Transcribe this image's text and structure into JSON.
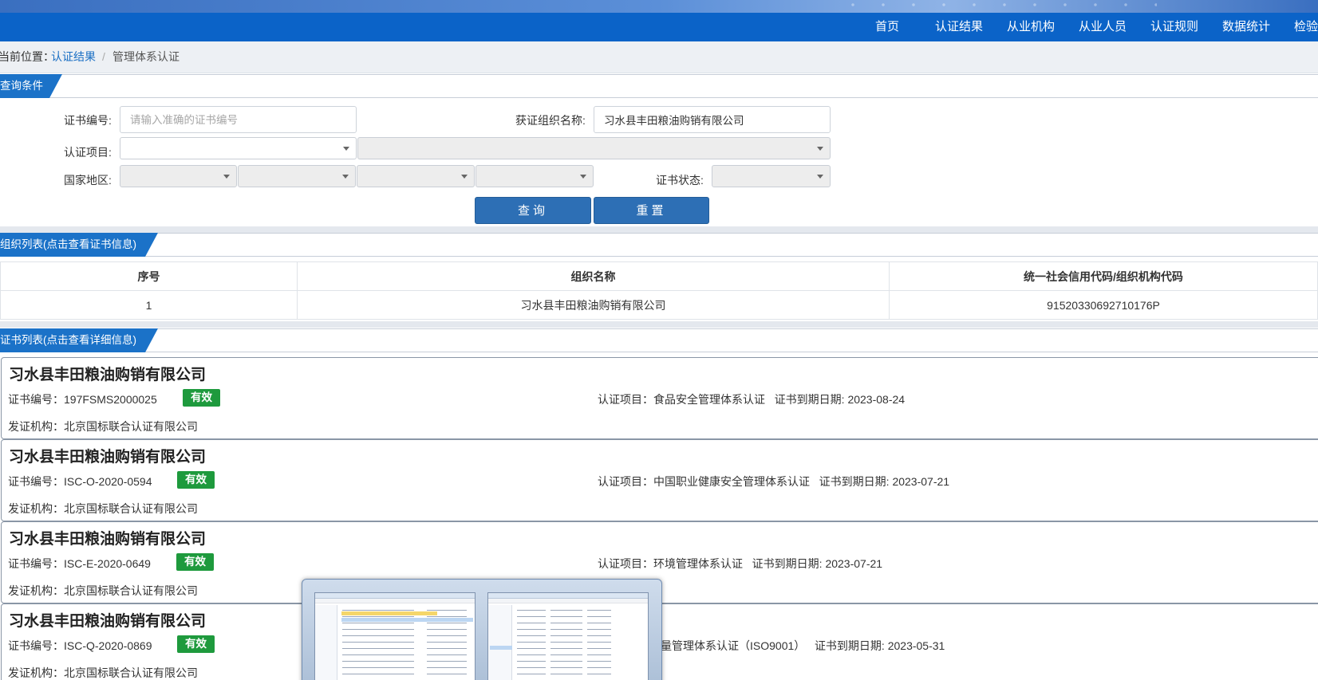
{
  "nav": [
    "首页",
    "认证结果",
    "从业机构",
    "从业人员",
    "认证规则",
    "数据统计",
    "检验"
  ],
  "breadcrumb": {
    "prefix": "当前位置：",
    "link": "认证结果",
    "sep": "/",
    "current": "管理体系认证"
  },
  "query": {
    "section_title": "查询条件",
    "cert_no_label": "证书编号:",
    "cert_no_placeholder": "请输入准确的证书编号",
    "org_name_label": "获证组织名称:",
    "org_name_value": "习水县丰田粮油购销有限公司",
    "cert_item_label": "认证项目:",
    "region_label": "国家地区:",
    "status_label": "证书状态:",
    "search_btn": "查询",
    "reset_btn": "重置"
  },
  "org_list": {
    "section_title": "组织列表(点击查看证书信息)",
    "headers": [
      "序号",
      "组织名称",
      "统一社会信用代码/组织机构代码"
    ],
    "rows": [
      [
        "1",
        "习水县丰田粮油购销有限公司",
        "91520330692710176P"
      ]
    ]
  },
  "cert_list": {
    "section_title": "证书列表(点击查看详细信息)",
    "no_label": "证书编号：",
    "item_label": "认证项目：",
    "expire_label": "证书到期日期:",
    "issuer_label": "发证机构：",
    "items": [
      {
        "org": "习水县丰田粮油购销有限公司",
        "cert_no": "197FSMS2000025",
        "status": "有效",
        "item": "食品安全管理体系认证",
        "expire": "2023-08-24",
        "issuer": "北京国标联合认证有限公司"
      },
      {
        "org": "习水县丰田粮油购销有限公司",
        "cert_no": "ISC-O-2020-0594",
        "status": "有效",
        "item": "中国职业健康安全管理体系认证",
        "expire": "2023-07-21",
        "issuer": "北京国标联合认证有限公司"
      },
      {
        "org": "习水县丰田粮油购销有限公司",
        "cert_no": "ISC-E-2020-0649",
        "status": "有效",
        "item": "环境管理体系认证",
        "expire": "2023-07-21",
        "issuer": "北京国标联合认证有限公司"
      },
      {
        "org": "习水县丰田粮油购销有限公司",
        "cert_no": "ISC-Q-2020-0869",
        "status": "有效",
        "item": "质量管理体系认证（ISO9001）",
        "item_visible": "量管理体系认证（ISO9001）",
        "expire": "2023-05-31",
        "issuer": "北京国标联合认证有限公司"
      }
    ]
  },
  "colors": {
    "nav_bg": "#0b63c8",
    "tab_bg": "#1b72c8",
    "button": "#2d6fb5",
    "badge": "#1e9a3d",
    "link": "#1a6fc4"
  }
}
